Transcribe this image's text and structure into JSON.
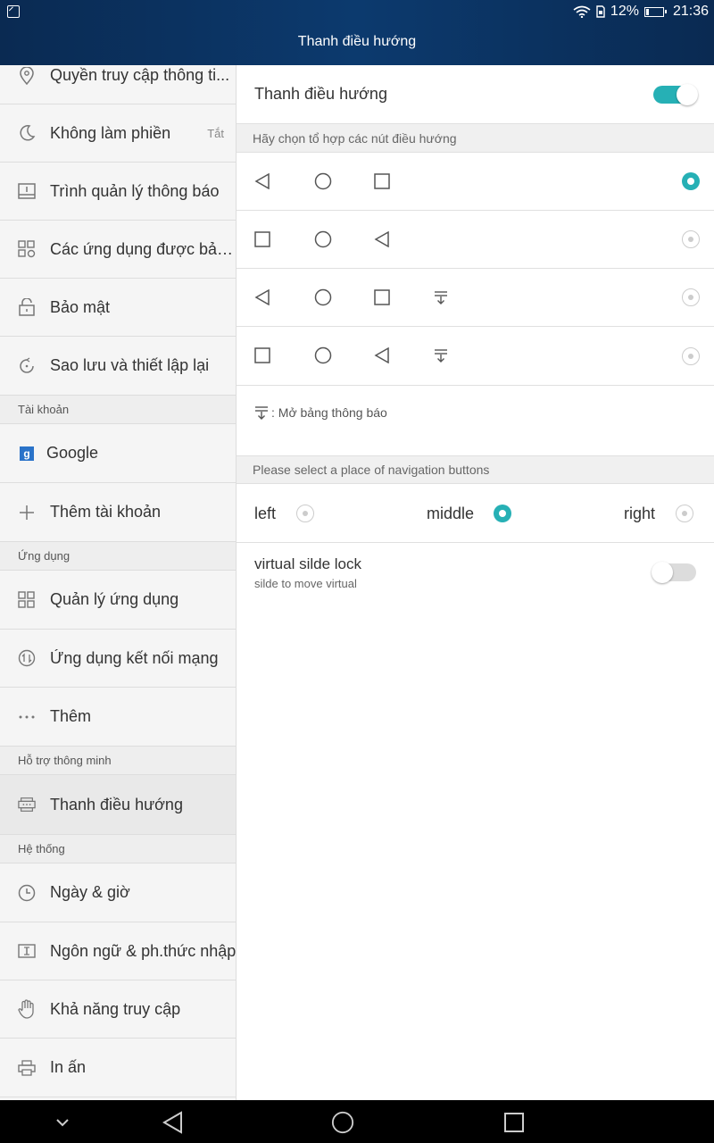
{
  "status_bar": {
    "battery": "12%",
    "time": "21:36"
  },
  "title": "Thanh điều hướng",
  "sidebar": {
    "items": [
      {
        "label": "Quyền truy cập thông ti...",
        "icon": "location-icon"
      },
      {
        "label": "Không làm phiền",
        "value": "Tắt",
        "icon": "moon-icon"
      },
      {
        "label": "Trình quản lý thông báo",
        "icon": "notification-manager-icon"
      },
      {
        "label": "Các ứng dụng được bảo...",
        "icon": "protected-apps-icon"
      },
      {
        "label": "Bảo mật",
        "icon": "lock-icon"
      },
      {
        "label": "Sao lưu và thiết lập lại",
        "icon": "backup-icon"
      }
    ],
    "header_accounts": "Tài khoản",
    "accounts": [
      {
        "label": "Google",
        "icon": "google-icon"
      },
      {
        "label": "Thêm tài khoản",
        "icon": "plus-icon"
      }
    ],
    "header_apps": "Ứng dụng",
    "apps": [
      {
        "label": "Quản lý ứng dụng",
        "icon": "apps-grid-icon"
      },
      {
        "label": "Ứng dụng kết nối mạng",
        "icon": "network-icon"
      },
      {
        "label": "Thêm",
        "icon": "more-icon"
      }
    ],
    "header_smart": "Hỗ trợ thông minh",
    "smart": [
      {
        "label": "Thanh điều hướng",
        "icon": "navbar-icon"
      }
    ],
    "header_system": "Hệ thống",
    "system": [
      {
        "label": "Ngày & giờ",
        "icon": "clock-icon"
      },
      {
        "label": "Ngôn ngữ & ph.thức nhập",
        "icon": "keyboard-icon"
      },
      {
        "label": "Khả năng truy cập",
        "icon": "hand-icon"
      },
      {
        "label": "In ấn",
        "icon": "printer-icon"
      }
    ]
  },
  "panel": {
    "navbar_toggle_label": "Thanh điều hướng",
    "navbar_toggle_on": true,
    "combo_header": "Hãy chọn tổ hợp các nút điều hướng",
    "combos": [
      {
        "buttons": [
          "back",
          "home",
          "recent"
        ],
        "selected": true
      },
      {
        "buttons": [
          "recent",
          "home",
          "back"
        ],
        "selected": false
      },
      {
        "buttons": [
          "back",
          "home",
          "recent",
          "notification"
        ],
        "selected": false
      },
      {
        "buttons": [
          "recent",
          "home",
          "back",
          "notification"
        ],
        "selected": false
      }
    ],
    "notification_note": ": Mở bảng thông báo",
    "place_header": "Please select a place of navigation buttons",
    "place_options": {
      "left": "left",
      "middle": "middle",
      "right": "right",
      "selected": "middle"
    },
    "virtual_lock_title": "virtual silde lock",
    "virtual_lock_subtitle": "silde to move virtual",
    "virtual_lock_on": false
  },
  "colors": {
    "accent": "#26b0b5",
    "topbar": "#0c3a6e"
  }
}
